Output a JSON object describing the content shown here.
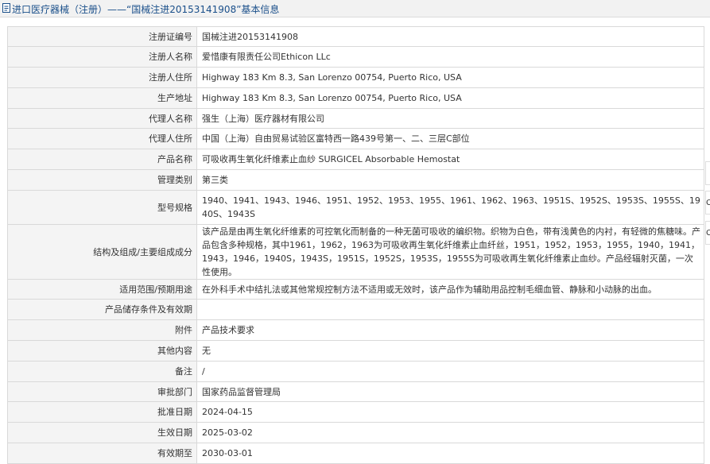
{
  "page": {
    "title": "进口医疗器械（注册）——“国械注进20153141908”基本信息"
  },
  "rows": [
    {
      "label": "注册证编号",
      "value": "国械注进20153141908"
    },
    {
      "label": "注册人名称",
      "value": "爱惜康有限责任公司Ethicon LLc"
    },
    {
      "label": "注册人住所",
      "value": "Highway 183 Km 8.3, San Lorenzo 00754, Puerto Rico, USA"
    },
    {
      "label": "生产地址",
      "value": "Highway 183 Km 8.3, San Lorenzo 00754, Puerto Rico, USA"
    },
    {
      "label": "代理人名称",
      "value": "强生（上海）医疗器材有限公司"
    },
    {
      "label": "代理人住所",
      "value": "中国（上海）自由贸易试验区富特西一路439号第一、二、三层C部位"
    },
    {
      "label": "产品名称",
      "value": "可吸收再生氧化纤维素止血纱 SURGICEL Absorbable Hemostat"
    },
    {
      "label": "管理类别",
      "value": "第三类"
    },
    {
      "label": "型号规格",
      "value": "1940、1941、1943、1946、1951、1952、1953、1955、1961、1962、1963、1951S、1952S、1953S、1955S、1940S、1943S"
    },
    {
      "label": "结构及组成/主要组成成分",
      "value": "该产品是由再生氧化纤维素的可控氧化而制备的一种无菌可吸收的编织物。织物为白色，带有浅黄色的内衬，有轻微的焦糖味。产品包含多种规格，其中1961，1962，1963为可吸收再生氧化纤维素止血纤丝，1951，1952，1953，1955，1940，1941，1943，1946，1940S，1943S，1951S，1952S，1953S，1955S为可吸收再生氧化纤维素止血纱。产品经辐射灭菌，一次性使用。"
    },
    {
      "label": "适用范围/预期用途",
      "value": "在外科手术中结扎法或其他常规控制方法不适用或无效时，该产品作为辅助用品控制毛细血管、静脉和小动脉的出血。"
    },
    {
      "label": "产品储存条件及有效期",
      "value": ""
    },
    {
      "label": "附件",
      "value": "产品技术要求"
    },
    {
      "label": "其他内容",
      "value": "无"
    },
    {
      "label": "备注",
      "value": "/"
    },
    {
      "label": "审批部门",
      "value": "国家药品监督管理局"
    },
    {
      "label": "批准日期",
      "value": "2024-04-15"
    },
    {
      "label": "生效日期",
      "value": "2025-03-02"
    },
    {
      "label": "有效期至",
      "value": "2030-03-01"
    }
  ],
  "side_tabs": [
    "",
    "C",
    "C"
  ],
  "colors": {
    "title_text": "#1a4f8a",
    "label_bg": "#f4f4f4",
    "border": "#d9d9d9"
  }
}
